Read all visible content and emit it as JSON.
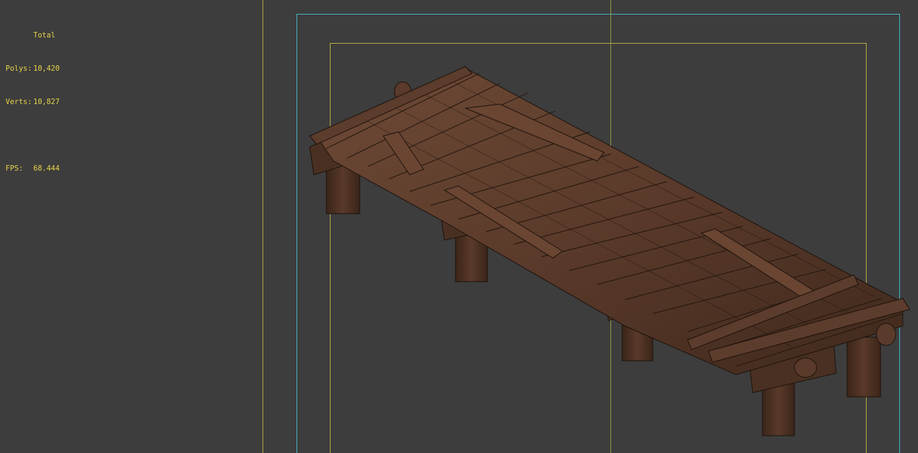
{
  "viewport_stats": {
    "header": "Total",
    "polys_label": "Polys:",
    "polys_value": "10,420",
    "verts_label": "Verts:",
    "verts_value": "10,827",
    "fps_label": "FPS:",
    "fps_value": "68.444"
  },
  "colors": {
    "viewport_bg": "#3d3d3d",
    "stats_text": "#e6d34a",
    "safe_frame_yellow": "#b9ad45",
    "safe_frame_cyan": "#45b7c8",
    "wood_light": "#6e4a36",
    "wood_mid": "#5a3a2a",
    "wood_dark": "#3a2519",
    "wireframe": "#1b110b"
  },
  "scene": {
    "object": "wooden-dock-wireframe-model"
  }
}
